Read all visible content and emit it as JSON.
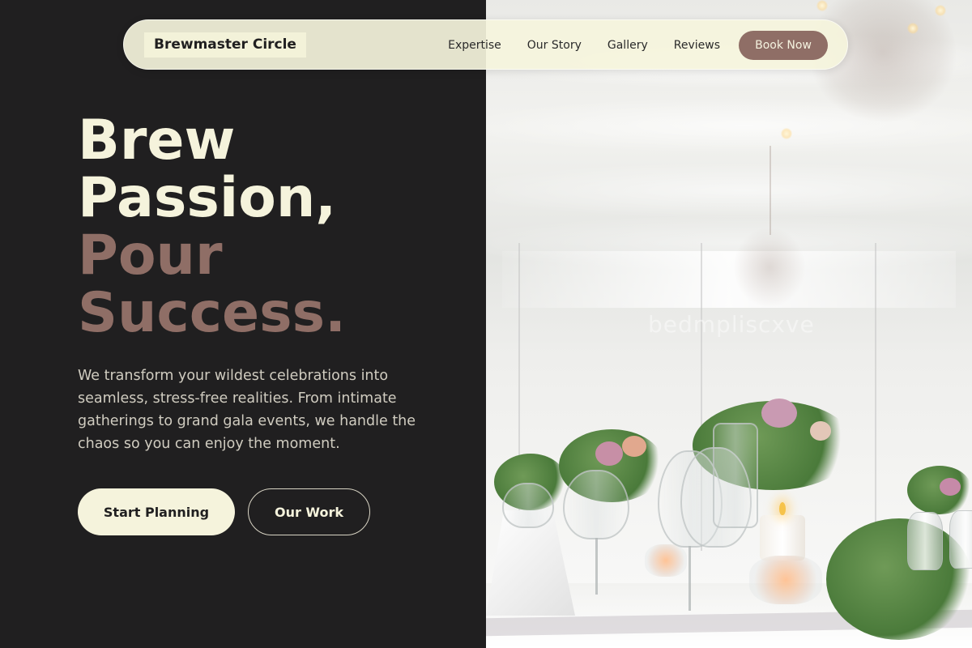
{
  "brand": {
    "name": "Brewmaster Circle"
  },
  "nav": {
    "links": [
      "Expertise",
      "Our Story",
      "Gallery",
      "Reviews"
    ],
    "cta": "Book Now"
  },
  "hero": {
    "title_lines": [
      "Brew",
      "Passion,",
      "Pour",
      "Success."
    ],
    "description": "We transform your wildest celebrations into seamless, stress-free realities. From intimate gatherings to grand gala events, we handle the chaos so you can enjoy the moment.",
    "primary_button": "Start Planning",
    "secondary_button": "Our Work"
  },
  "image": {
    "watermark": "bedmpliscxve"
  },
  "colors": {
    "background": "#201f20",
    "cream": "#f5f3dc",
    "accent": "#8f6e66",
    "nav_background": "#f5f4dc",
    "body_text": "#d0ccc0"
  }
}
